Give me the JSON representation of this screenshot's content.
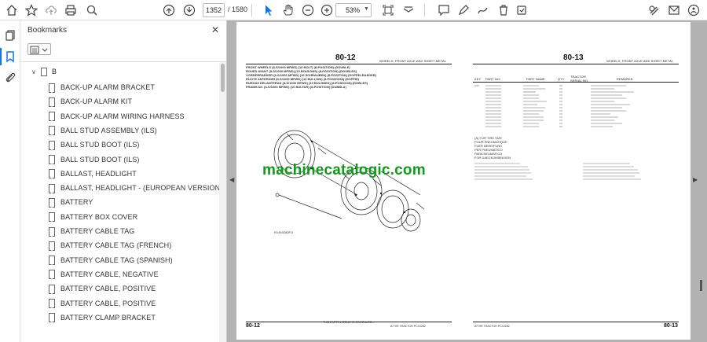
{
  "toolbar": {
    "current_page": "1352",
    "total_pages": "/ 1580",
    "zoom": "53%",
    "icons": [
      "home-icon",
      "star-icon",
      "upload-icon",
      "print-icon",
      "search-icon",
      "page-up-icon",
      "page-down-icon",
      "select-cursor-icon",
      "hand-icon",
      "zoom-out-icon",
      "zoom-in-icon",
      "fit-page-icon",
      "read-mode-icon",
      "comment-icon",
      "highlight-icon",
      "draw-icon",
      "delete-icon",
      "sign-icon",
      "email-icon",
      "account-icon"
    ]
  },
  "rail": {
    "icons": [
      "pages-thumbnails-icon",
      "bookmark-icon",
      "attachment-icon"
    ]
  },
  "bookmarks": {
    "title": "Bookmarks",
    "close": "✕",
    "root_label": "B",
    "items": [
      "BACK-UP ALARM BRACKET",
      "BACK-UP ALARM KIT",
      "BACK-UP ALARM WIRING HARNESS",
      "BALL STUD ASSEMBLY (ILS)",
      "BALL STUD BOOT (ILS)",
      "BALL STUD BOOT (ILS)",
      "BALLAST, HEADLIGHT",
      "BALLAST, HEADLIGHT - (EUROPEAN VERSION)",
      "BATTERY",
      "BATTERY BOX COVER",
      "BATTERY CABLE TAG",
      "BATTERY CABLE TAG (FRENCH)",
      "BATTERY CABLE TAG (SPANISH)",
      "BATTERY CABLE, NEGATIVE",
      "BATTERY CABLE, POSITIVE",
      "BATTERY CABLE, POSITIVE",
      "BATTERY CLAMP BRACKET"
    ]
  },
  "document": {
    "left_page": {
      "number": "80-12",
      "section": "WHEELS, FRONT AXLE AND SHEET METAL",
      "caption_lines": [
        "FRONT WHEELS (ILS/1000 MFWD) (10 BOLT) (8-POSITION) (DOUBLE)",
        "ROUES AVANT (ILS/1000 MFWD) (10 BOULONS) (8-POSITION) (DOUBLES)",
        "VORDERRAEDER (ILS/1000 MFWD) (10 SCHRAUBEN) (8-POSITION) (DOPPELRAEDER)",
        "RUOTE ANTERIORI (ILS/1000 MFWD) (10 BULLONI) (8-POSIZIONI) (DOPPIE)",
        "RUEDAS DELANTERAS (ILS/1000 MFWD) (10 BULONES) (8-POSICION) (DOBLES)",
        "FRAMHJUL (ILS/1000 MFWD) (10 BULTAR) (8-POSITION) (DUBBLA)"
      ],
      "drawing_id": "R1450283FO",
      "footer_left": "80-12",
      "footer_center": "THIS PARTS LISTING IS CONTINUED...",
      "footer_right": "8770R TRACTOR   PC10282"
    },
    "right_page": {
      "number": "80-13",
      "section": "WHEELS, FRONT AXLE AND SHEET METAL",
      "table_headers": [
        "KEY",
        "PART NO.",
        "PART NAME",
        "QTY",
        "TRACTOR SERIAL NO.",
        "REMARKS"
      ],
      "footnote_lines": [
        "(A) FOR TIRE SIZE",
        "POUR PNEUMATIQUE",
        "FUER BEREIFUNG",
        "PER PNEUMATICO",
        "PARA NEUMATICO",
        "FOR DAECKDIMENSION"
      ],
      "footer_left": "8770R TRACTOR   PC10282",
      "footer_right": "80-13"
    },
    "watermark": "machinecatalogic.com"
  }
}
